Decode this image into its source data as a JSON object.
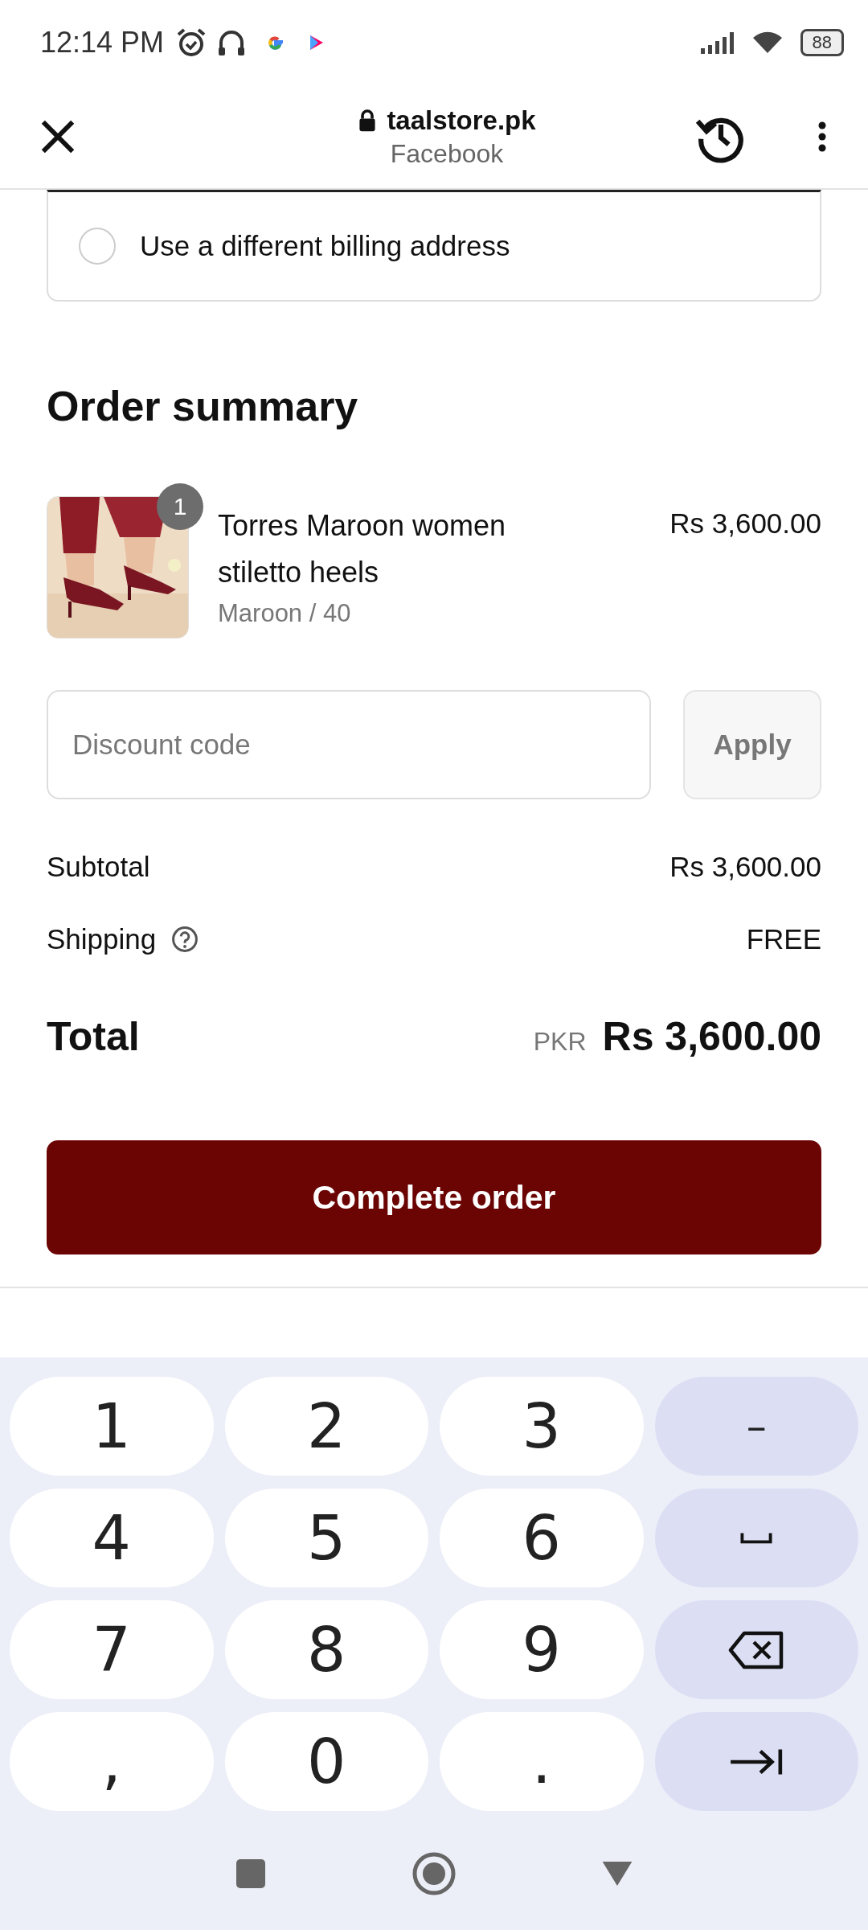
{
  "status_bar": {
    "time": "12:14 PM",
    "battery": "88"
  },
  "browser": {
    "domain": "taalstore.pk",
    "subtitle": "Facebook"
  },
  "billing_option": {
    "label": "Use a different billing address",
    "selected": false
  },
  "order_summary": {
    "title": "Order summary",
    "items": [
      {
        "name": "Torres Maroon women stiletto heels",
        "variant": "Maroon / 40",
        "price": "Rs 3,600.00",
        "quantity": "1"
      }
    ]
  },
  "discount": {
    "placeholder": "Discount code",
    "button": "Apply"
  },
  "totals": [
    {
      "label": "Subtotal",
      "value": "Rs 3,600.00",
      "kind": "plain"
    },
    {
      "label": "Shipping",
      "value": "FREE",
      "kind": "help"
    }
  ],
  "total": {
    "label": "Total",
    "currency": "PKR",
    "value": "Rs 3,600.00"
  },
  "complete_button": "Complete order",
  "keyboard": [
    {
      "kind": "digit",
      "label": "1"
    },
    {
      "kind": "digit",
      "label": "2"
    },
    {
      "kind": "digit",
      "label": "3"
    },
    {
      "kind": "dash",
      "label": "–"
    },
    {
      "kind": "digit",
      "label": "4"
    },
    {
      "kind": "digit",
      "label": "5"
    },
    {
      "kind": "digit",
      "label": "6"
    },
    {
      "kind": "space"
    },
    {
      "kind": "digit",
      "label": "7"
    },
    {
      "kind": "digit",
      "label": "8"
    },
    {
      "kind": "digit",
      "label": "9"
    },
    {
      "kind": "backspace"
    },
    {
      "kind": "digit",
      "label": ","
    },
    {
      "kind": "digit",
      "label": "0"
    },
    {
      "kind": "digit",
      "label": "."
    },
    {
      "kind": "tab"
    }
  ]
}
